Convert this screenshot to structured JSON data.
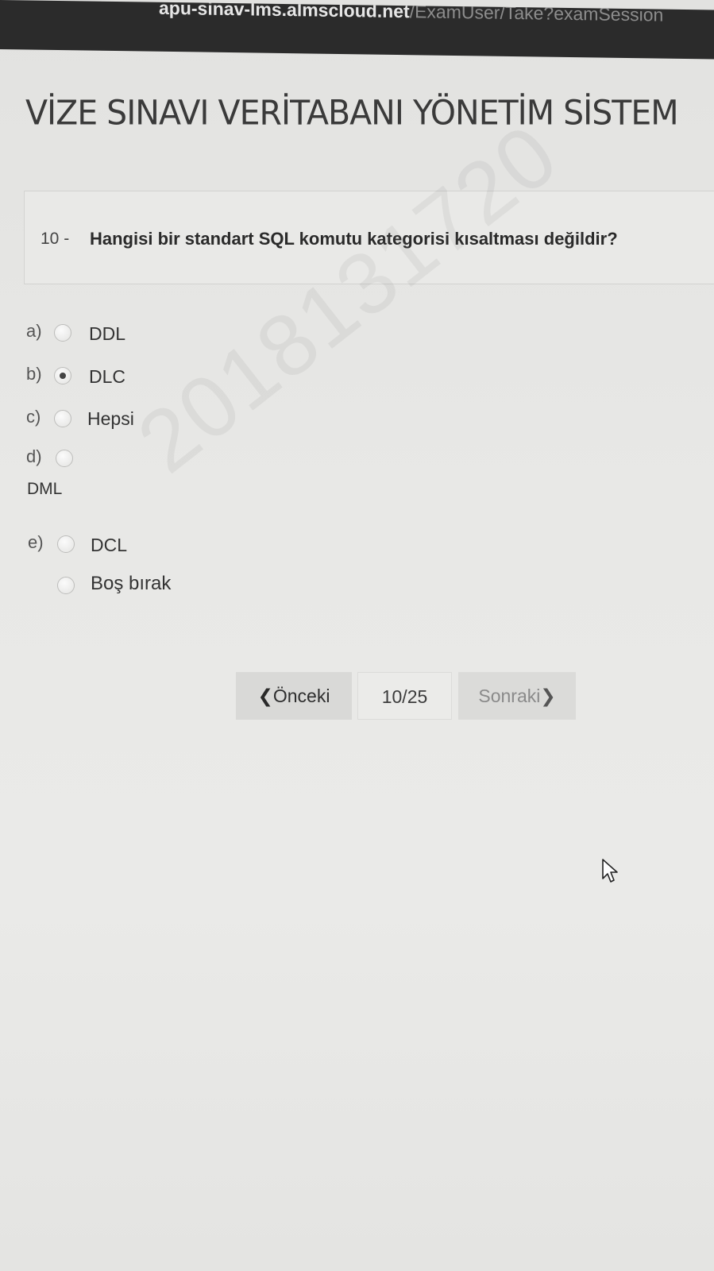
{
  "browser": {
    "url_host": "apu-sinav-lms.almscloud.net",
    "url_path": "/ExamUser/Take?examSession"
  },
  "page": {
    "title": "VİZE SINAVI VERİTABANI YÖNETİM SİSTEM"
  },
  "question": {
    "number": "10 -",
    "text": "Hangisi bir standart SQL komutu kategorisi kısaltması değildir?"
  },
  "options": [
    {
      "letter": "a)",
      "label": "DDL",
      "selected": false
    },
    {
      "letter": "b)",
      "label": "DLC",
      "selected": true
    },
    {
      "letter": "c)",
      "label": "Hepsi",
      "selected": false
    },
    {
      "letter": "d)",
      "label": "DML",
      "selected": false
    },
    {
      "letter": "e)",
      "label": "DCL",
      "selected": false
    },
    {
      "letter": "",
      "label": "Boş bırak",
      "selected": false
    }
  ],
  "watermark": "2018131720",
  "pager": {
    "prev_label": "Önceki",
    "prev_icon": "chevron-left-icon",
    "prev_chevron": "❮",
    "page_indicator": "10/25",
    "next_label": "Sonraki",
    "next_icon": "chevron-right-icon",
    "next_chevron": "❯"
  },
  "colors": {
    "background": "#e8e8e6",
    "url_bar": "#2b2b2b",
    "title_text": "#3a3a3a",
    "selected_dot": "#444444"
  }
}
